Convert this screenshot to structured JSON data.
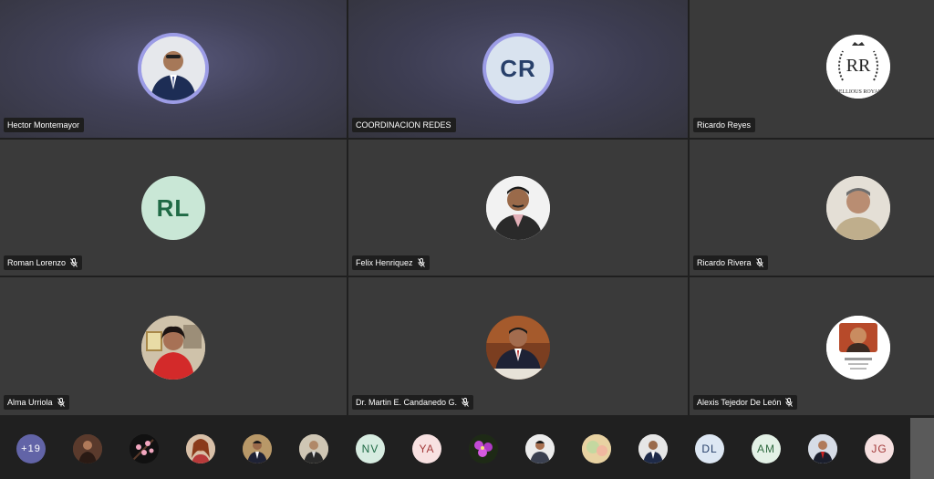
{
  "participants": [
    {
      "name": "Hector Montemayor",
      "avatar": "photo"
    },
    {
      "name": "COORDINACION REDES",
      "initials": "CR"
    },
    {
      "name": "Ricardo Reyes",
      "avatar": "logo",
      "logo_text": "RR",
      "logo_caption": "REBELLIOUS ROYALTY"
    },
    {
      "name": "Roman Lorenzo",
      "initials": "RL",
      "muted": true
    },
    {
      "name": "Felix Henriquez",
      "avatar": "photo",
      "muted": true
    },
    {
      "name": "Ricardo Rivera",
      "avatar": "photo",
      "muted": true
    },
    {
      "name": "Alma Urriola",
      "avatar": "photo",
      "muted": true
    },
    {
      "name": "Dr. Martin E. Candanedo G.",
      "avatar": "photo",
      "muted": true
    },
    {
      "name": "Alexis Tejedor De León",
      "avatar": "photo",
      "muted": true
    }
  ],
  "overflow_count": "+19",
  "strip": [
    {
      "avatar": "photo"
    },
    {
      "avatar": "image",
      "icon": "cherry-blossom-icon"
    },
    {
      "avatar": "photo"
    },
    {
      "avatar": "photo"
    },
    {
      "avatar": "photo"
    },
    {
      "initials": "NV"
    },
    {
      "initials": "YA"
    },
    {
      "avatar": "image",
      "icon": "flower-icon"
    },
    {
      "avatar": "photo"
    },
    {
      "avatar": "image"
    },
    {
      "avatar": "photo"
    },
    {
      "initials": "DL"
    },
    {
      "initials": "AM"
    },
    {
      "avatar": "photo"
    },
    {
      "initials": "JG"
    }
  ],
  "colors": {
    "speaking_ring": "#9c9ce6",
    "tile_bg": "#3a3a3a",
    "cr_bg": "#d9e3ef",
    "cr_fg": "#28406a",
    "rl_bg": "#c9e7d6",
    "rl_fg": "#1f6a45",
    "overflow_bg": "#6264a7"
  }
}
